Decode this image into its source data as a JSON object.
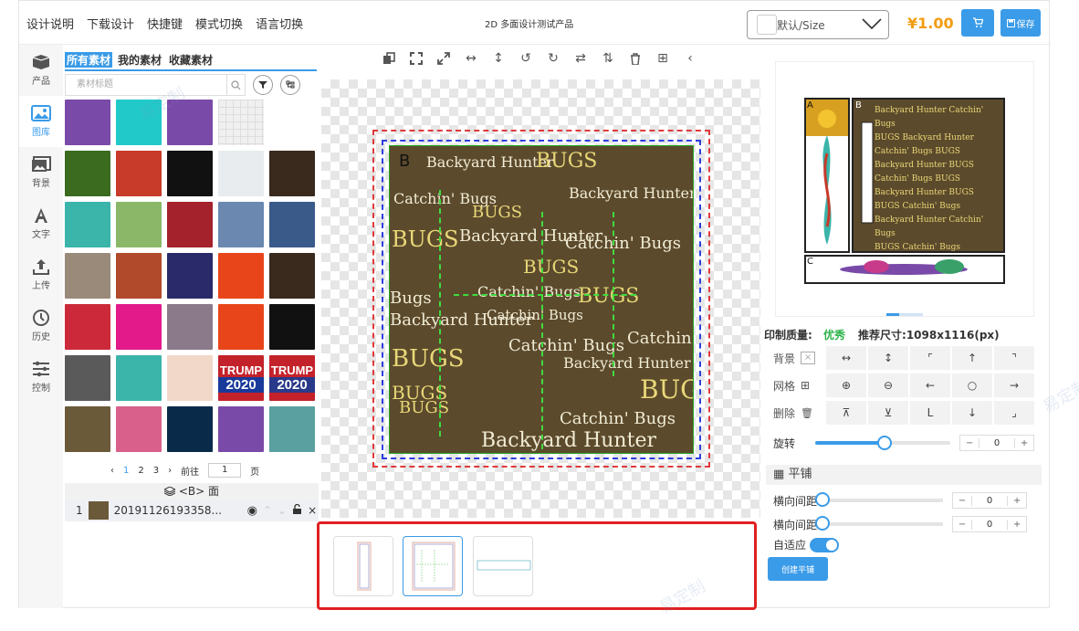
{
  "topbar": {
    "menu": [
      "设计说明",
      "下载设计",
      "快捷键",
      "模式切换",
      "语言切换"
    ],
    "product_title": "2D 多面设计测试产品",
    "size_select": "默认/Size",
    "price": "¥1.00",
    "save_label": "保存"
  },
  "iconbar": {
    "items": [
      {
        "label": "产品",
        "icon": "product-icon"
      },
      {
        "label": "图库",
        "icon": "gallery-icon"
      },
      {
        "label": "背景",
        "icon": "background-icon"
      },
      {
        "label": "文字",
        "icon": "text-icon"
      },
      {
        "label": "上传",
        "icon": "upload-icon"
      },
      {
        "label": "历史",
        "icon": "history-icon"
      },
      {
        "label": "控制",
        "icon": "control-icon"
      }
    ]
  },
  "assets": {
    "tabs": [
      "所有素材",
      "我的素材",
      "收藏素材"
    ],
    "search_placeholder": "素材标题",
    "thumb_colors": [
      "#7a4aa8",
      "#22c9c9",
      "#7a4aa8",
      "#f0f0f0",
      "#ffffff",
      "#3a6b1e",
      "#c83a2a",
      "#111111",
      "#e8ecef",
      "#3a2a1e",
      "#3bb4a9",
      "#8ab868",
      "#a3222b",
      "#6a88b0",
      "#3a5a8a",
      "#9a8a7a",
      "#b04a2a",
      "#2a2a6a",
      "#e8461a",
      "#3a2a1e",
      "#cc2a3a",
      "#e21a8a",
      "#8a7a8a",
      "#e8461a",
      "#111111",
      "#5a5a5a",
      "#3bb4a9",
      "#f2d8c8",
      "#c4222b",
      "#c4222b",
      "#6b5a3a",
      "#d8608a",
      "#0a2a4a",
      "#7a4aa8",
      "#5aa0a0"
    ],
    "trump_label": "TRUMP",
    "trump_year": "2020",
    "pager": {
      "prev": "‹",
      "pages": [
        "1",
        "2",
        "3"
      ],
      "next": "›",
      "goto_label": "前往",
      "goto_value": "1",
      "page_suffix": "页"
    },
    "layer_header": "<B> 面",
    "layer": {
      "index": "1",
      "name": "20191126193358..."
    }
  },
  "canvas": {
    "face_label": "B",
    "words": [
      "Backyard Hunter",
      "BUGS",
      "Catchin' Bugs",
      "BUGS",
      "Backyard Hunter",
      "BUGS",
      "Backyard Hunter",
      "Catchin' Bugs",
      "BUGS",
      "Catchin' Bugs",
      "BUGS",
      "Catchin' Bugs",
      "Bugs",
      "Backyard Hunter",
      "Catchin' Bugs",
      "BUGS",
      "Backyard Hunter",
      "BUGS",
      "Catchin' Bugs",
      "BUGS",
      "Catchin' Bugs",
      "BUGS",
      "Backyard Hunter"
    ]
  },
  "preview": {
    "labels": [
      "A",
      "B",
      "C"
    ]
  },
  "controls": {
    "quality_label": "印制质量:",
    "quality_value": "优秀",
    "recommended": "推荐尺寸:1098x1116(px)",
    "rows": [
      {
        "label": "背景",
        "icons": [
          "×",
          "↔",
          "↕",
          "⌜",
          "↑",
          "⌝"
        ]
      },
      {
        "label": "网格",
        "icons": [
          "⊞",
          "⊕",
          "⊖",
          "←",
          "○",
          "→"
        ]
      },
      {
        "label": "删除",
        "icons": [
          "🗑",
          "⊼",
          "⊻",
          "L",
          "↓",
          "⌟"
        ]
      }
    ],
    "rotate_label": "旋转",
    "rotate_value": "0",
    "tile_label": "平铺",
    "h_spacing_label": "横向间距",
    "h_spacing_value": "0",
    "v_spacing_label": "横向间距",
    "v_spacing_value": "0",
    "auto_fit_label": "自适应",
    "create_tile_label": "创建平铺"
  },
  "watermark": "易定制"
}
